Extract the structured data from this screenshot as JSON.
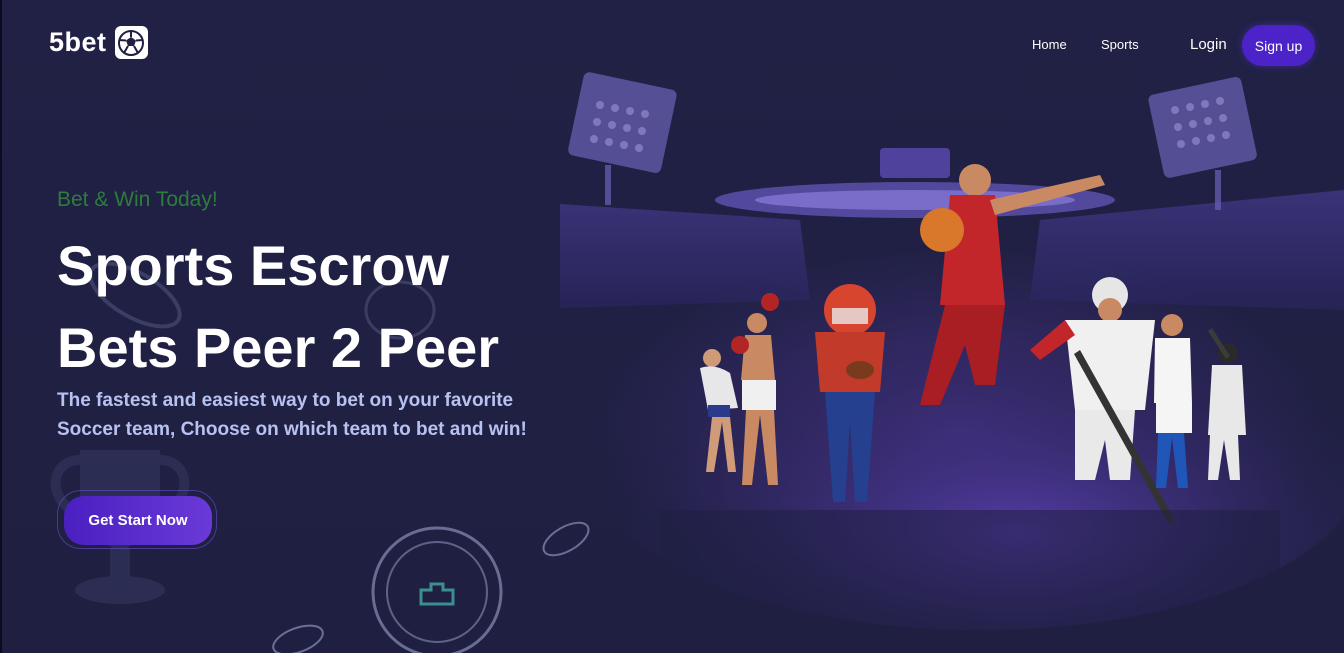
{
  "brand": {
    "name": "5bet",
    "logo_icon": "soccer-ball-icon"
  },
  "nav": {
    "items": [
      {
        "label": "Home"
      },
      {
        "label": "Sports"
      }
    ],
    "login_label": "Login",
    "signup_label": "Sign up"
  },
  "hero": {
    "eyebrow": "Bet & Win Today!",
    "headline_line1": "Sports Escrow",
    "headline_line2": "Bets Peer 2 Peer",
    "subtext_line1": "The fastest and easiest way to bet on your favorite",
    "subtext_line2": "Soccer team, Choose on which team to bet and win!",
    "cta_label": "Get Start Now"
  },
  "colors": {
    "background": "#1f1f42",
    "accent": "#4b23c8",
    "eyebrow": "#2c7d3b",
    "subtext": "#b7c2f0"
  },
  "illustration": {
    "icons": [
      "stadium-illustration",
      "athletes-illustration",
      "coin-icon",
      "trophy-icon"
    ]
  }
}
